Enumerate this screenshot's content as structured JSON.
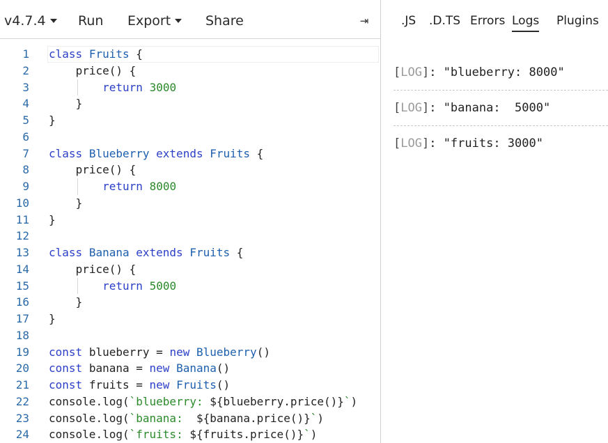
{
  "toolbar": {
    "version_label": "v4.7.4",
    "run_label": "Run",
    "export_label": "Export",
    "share_label": "Share",
    "collapse_icon": "⇥"
  },
  "right_tabs": [
    {
      "label": ".JS",
      "active": false
    },
    {
      "label": ".D.TS",
      "active": false
    },
    {
      "label": "Errors",
      "active": false
    },
    {
      "label": "Logs",
      "active": true
    },
    {
      "label": "Plugins",
      "active": false
    }
  ],
  "editor": {
    "line_numbers": [
      "1",
      "2",
      "3",
      "4",
      "5",
      "6",
      "7",
      "8",
      "9",
      "10",
      "11",
      "12",
      "13",
      "14",
      "15",
      "16",
      "17",
      "18",
      "19",
      "20",
      "21",
      "22",
      "23",
      "24"
    ],
    "lines": [
      "class Fruits {",
      "    price() {",
      "        return 3000",
      "    }",
      "}",
      "",
      "class Blueberry extends Fruits {",
      "    price() {",
      "        return 8000",
      "    }",
      "}",
      "",
      "class Banana extends Fruits {",
      "    price() {",
      "        return 5000",
      "    }",
      "}",
      "",
      "const blueberry = new Blueberry()",
      "const banana = new Banana()",
      "const fruits = new Fruits()",
      "console.log(`blueberry: ${blueberry.price()}`)",
      "console.log(`banana:  ${banana.price()}`)",
      "console.log(`fruits: ${fruits.price()}`)"
    ]
  },
  "logs": [
    {
      "open": "[",
      "tag": "LOG",
      "close": "]",
      "message": ": \"blueberry: 8000\""
    },
    {
      "open": "[",
      "tag": "LOG",
      "close": "]",
      "message": ": \"banana:  5000\""
    },
    {
      "open": "[",
      "tag": "LOG",
      "close": "]",
      "message": ": \"fruits: 3000\""
    }
  ],
  "colors": {
    "keyword": "#2c40c8",
    "number": "#2b8a2b",
    "line_number": "#2b6aa8",
    "log_tag": "#9a9a9a"
  }
}
